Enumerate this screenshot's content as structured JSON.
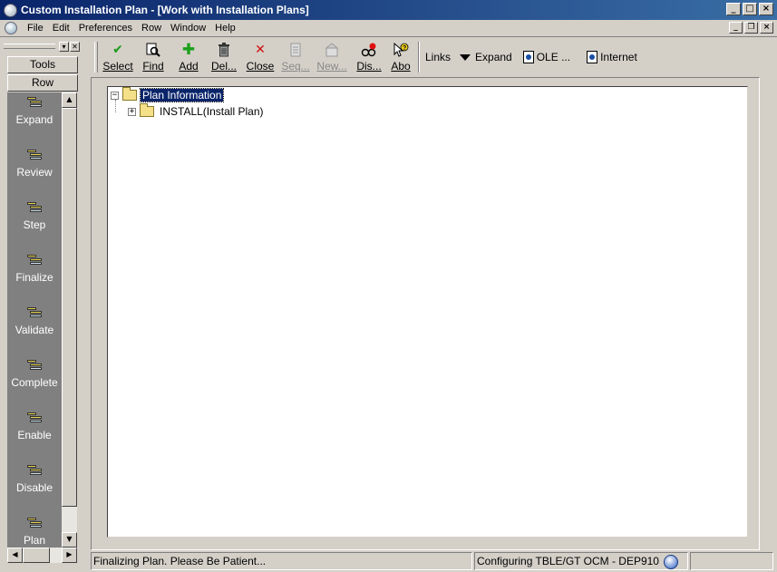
{
  "window": {
    "title": "Custom Installation Plan - [Work with Installation Plans]",
    "min": "_",
    "max": "□",
    "close": "×",
    "mdi_restore": "❐"
  },
  "menu": [
    "File",
    "Edit",
    "Preferences",
    "Row",
    "Window",
    "Help"
  ],
  "toolbar": {
    "buttons": [
      {
        "label": "Select",
        "icon": "checkmark-icon",
        "enabled": true
      },
      {
        "label": "Find",
        "icon": "find-icon",
        "enabled": true
      },
      {
        "label": "Add",
        "icon": "plus-icon",
        "enabled": true
      },
      {
        "label": "Del...",
        "icon": "trash-icon",
        "enabled": true
      },
      {
        "label": "Close",
        "icon": "x-icon",
        "enabled": true
      },
      {
        "label": "Seq...",
        "icon": "sequence-icon",
        "enabled": false
      },
      {
        "label": "New...",
        "icon": "new-icon",
        "enabled": false
      },
      {
        "label": "Dis...",
        "icon": "display-icon",
        "enabled": true
      },
      {
        "label": "Abo",
        "icon": "about-icon",
        "enabled": true
      }
    ],
    "links_label": "Links",
    "expand_label": "Expand",
    "ole_label": "OLE ...",
    "internet_label": "Internet"
  },
  "left_panel": {
    "tools_tab": "Tools",
    "row_tab": "Row",
    "items": [
      "Expand",
      "Review",
      "Step",
      "Finalize",
      "Validate",
      "Complete",
      "Enable",
      "Disable",
      "Plan"
    ]
  },
  "tree": {
    "root": {
      "label": "Plan Information",
      "expanded": true,
      "selected": true
    },
    "children": [
      {
        "label": "INSTALL(Install Plan)",
        "expanded": false
      }
    ],
    "collapse_glyph": "−",
    "expand_glyph": "+"
  },
  "status": {
    "message": "Finalizing Plan. Please Be Patient...",
    "environment": "Configuring TBLE/GT OCM - DEP910"
  },
  "colors": {
    "titlebar": "#0a246a",
    "selection": "#0a246a",
    "tools_panel": "#808080"
  }
}
